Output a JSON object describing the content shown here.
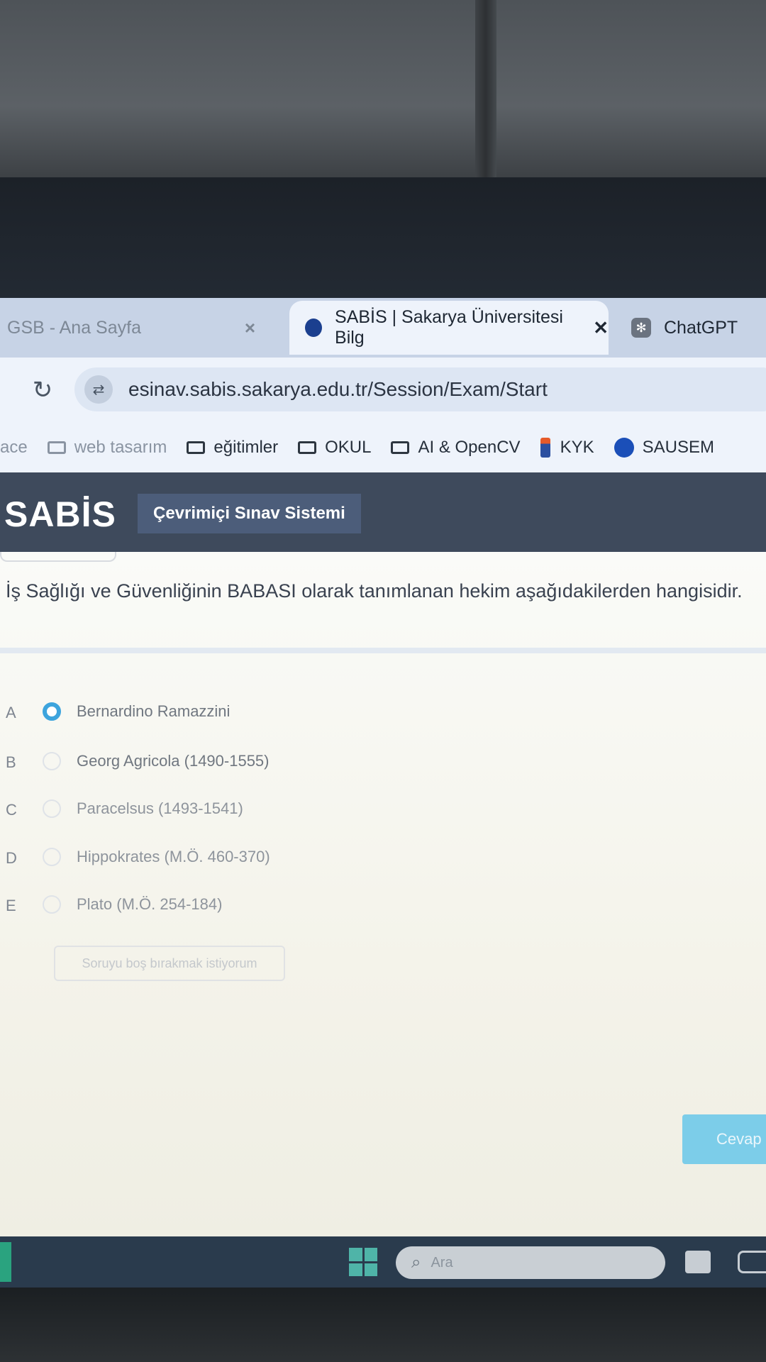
{
  "browser": {
    "tabs": [
      {
        "label": "GSB - Ana Sayfa",
        "state": "inactive"
      },
      {
        "label": "SABİS | Sakarya Üniversitesi Bilg",
        "state": "active"
      },
      {
        "label": "ChatGPT",
        "state": "inactive"
      }
    ],
    "url": "esinav.sabis.sakarya.edu.tr/Session/Exam/Start",
    "bookmarks": [
      {
        "label": "ace",
        "icon": "none"
      },
      {
        "label": "web tasarım",
        "icon": "folder-icon"
      },
      {
        "label": "eğitimler",
        "icon": "folder-icon"
      },
      {
        "label": "OKUL",
        "icon": "folder-icon"
      },
      {
        "label": "AI & OpenCV",
        "icon": "folder-icon"
      },
      {
        "label": "KYK",
        "icon": "kyk-icon"
      },
      {
        "label": "SAUSEM",
        "icon": "sausem-icon"
      }
    ]
  },
  "app": {
    "logo": "SABİS",
    "subtitle": "Çevrimiçi Sınav Sistemi"
  },
  "exam": {
    "question": "İş Sağlığı ve Güvenliğinin BABASI olarak tanımlanan hekim aşağıdakilerden hangisidir.",
    "options": [
      {
        "letter": "A",
        "text": "Bernardino Ramazzini",
        "selected": true
      },
      {
        "letter": "B",
        "text": "Georg Agricola (1490-1555)",
        "selected": false
      },
      {
        "letter": "C",
        "text": "Paracelsus (1493-1541)",
        "selected": false
      },
      {
        "letter": "D",
        "text": "Hippokrates (M.Ö. 460-370)",
        "selected": false
      },
      {
        "letter": "E",
        "text": "Plato (M.Ö. 254-184)",
        "selected": false
      }
    ],
    "skip_label": "Soruyu boş bırakmak istiyorum",
    "answer_label": "Cevap"
  },
  "taskbar": {
    "search_placeholder": "Ara"
  },
  "colors": {
    "header": "#3e4a5c",
    "accent": "#3da4dd",
    "answer_button": "#7ccde9"
  }
}
